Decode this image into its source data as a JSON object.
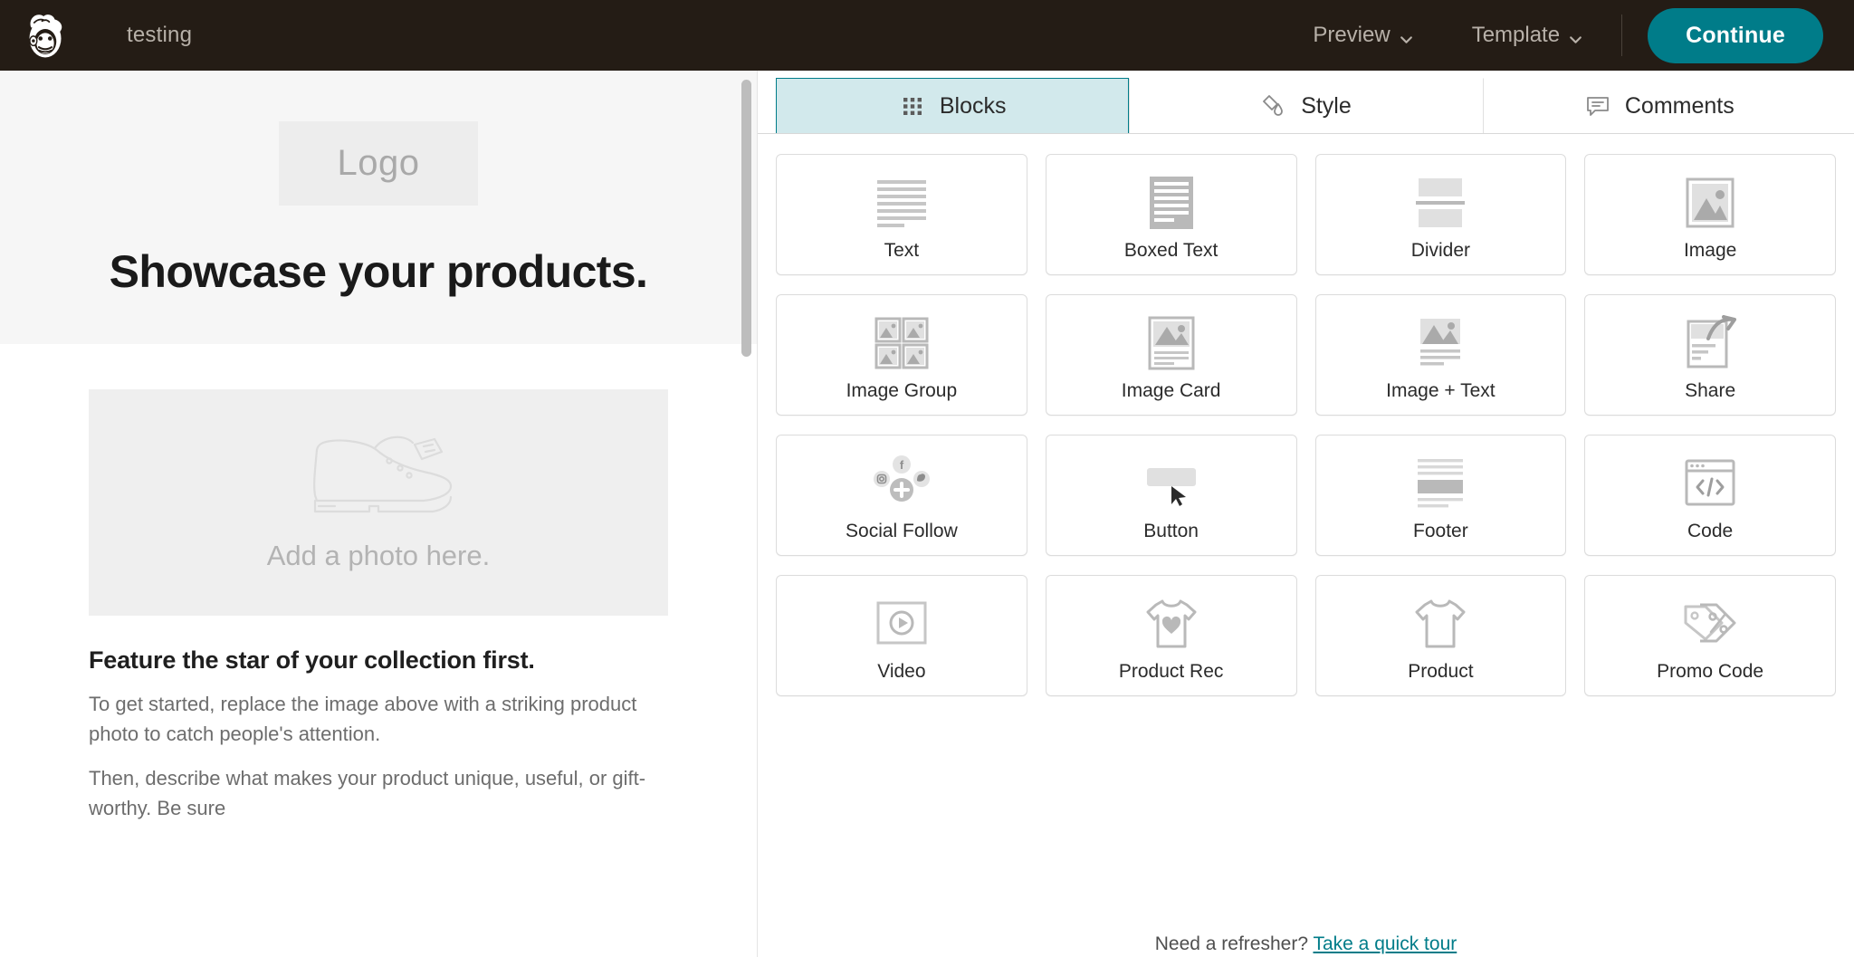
{
  "topbar": {
    "logo_icon": "mailchimp-freddie-logo",
    "campaign_name": "testing",
    "preview_label": "Preview",
    "template_label": "Template",
    "continue_label": "Continue",
    "accent_color": "#007c89",
    "background_color": "#241c15"
  },
  "canvas": {
    "logo_placeholder": "Logo",
    "hero_title": "Showcase your products.",
    "photo_placeholder_label": "Add a photo here.",
    "photo_placeholder_icon": "shoe-illustration",
    "sub_heading": "Feature the star of your collection first.",
    "paragraph_1": "To get started, replace the image above with a striking product photo to catch people's attention.",
    "paragraph_2": "Then, describe what makes your product unique, useful, or gift-worthy. Be sure"
  },
  "panel": {
    "tabs": [
      {
        "label": "Blocks",
        "icon": "grid-dots-icon",
        "active": true
      },
      {
        "label": "Style",
        "icon": "paint-style-icon",
        "active": false
      },
      {
        "label": "Comments",
        "icon": "comment-bubble-icon",
        "active": false
      }
    ],
    "blocks": [
      {
        "label": "Text",
        "icon": "text-lines-icon"
      },
      {
        "label": "Boxed Text",
        "icon": "boxed-text-icon"
      },
      {
        "label": "Divider",
        "icon": "divider-icon"
      },
      {
        "label": "Image",
        "icon": "image-icon"
      },
      {
        "label": "Image Group",
        "icon": "image-group-icon"
      },
      {
        "label": "Image Card",
        "icon": "image-card-icon"
      },
      {
        "label": "Image + Text",
        "icon": "image-text-icon"
      },
      {
        "label": "Share",
        "icon": "share-arrow-icon"
      },
      {
        "label": "Social Follow",
        "icon": "social-follow-icon"
      },
      {
        "label": "Button",
        "icon": "button-cursor-icon"
      },
      {
        "label": "Footer",
        "icon": "footer-icon"
      },
      {
        "label": "Code",
        "icon": "code-window-icon"
      },
      {
        "label": "Video",
        "icon": "video-play-icon"
      },
      {
        "label": "Product Rec",
        "icon": "tshirt-heart-icon"
      },
      {
        "label": "Product",
        "icon": "tshirt-icon"
      },
      {
        "label": "Promo Code",
        "icon": "promo-tag-icon"
      }
    ],
    "footer_note_text": "Need a refresher?",
    "footer_note_link": "Take a quick tour"
  }
}
